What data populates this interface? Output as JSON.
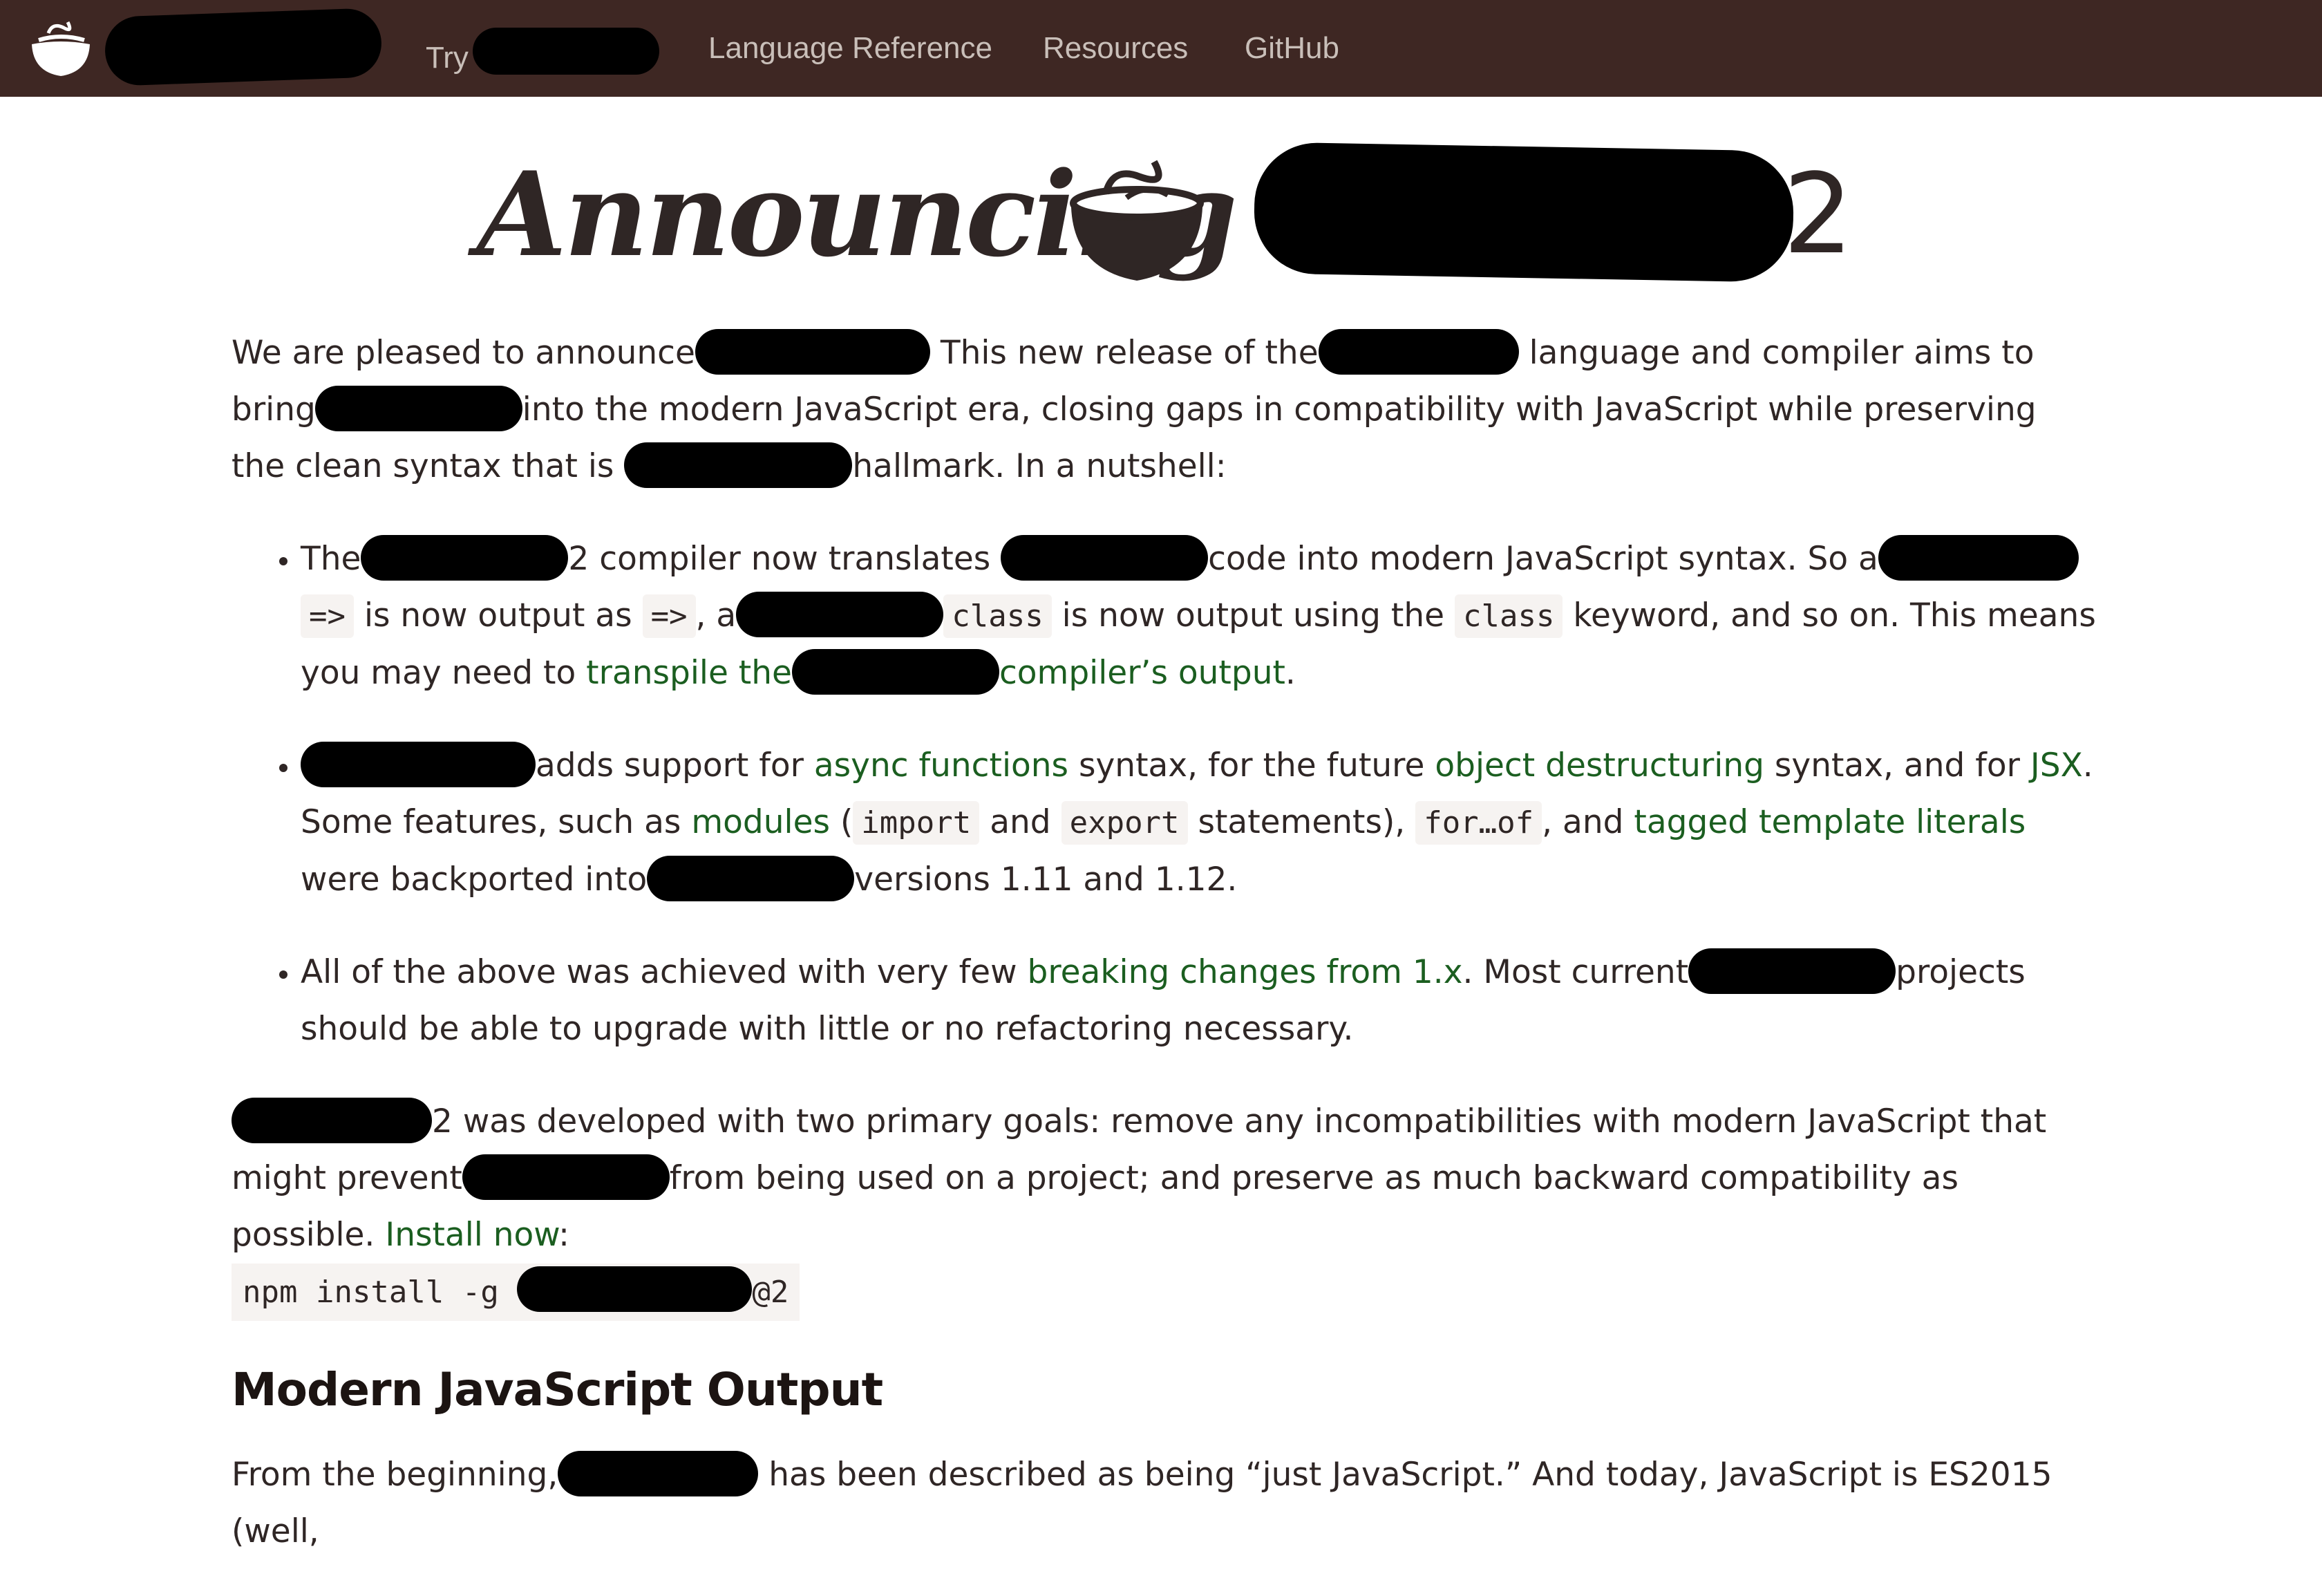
{
  "nav": {
    "try_label": "Try",
    "language_reference": "Language Reference",
    "resources": "Resources",
    "github": "GitHub"
  },
  "hero": {
    "announcing": "Announcing",
    "version": "2"
  },
  "intro": {
    "p1_a": "We are pleased to announce",
    "p1_b": "This new release of the",
    "p1_c": "language and compiler aims to bring",
    "p1_d": "into the modern JavaScript era, closing gaps in compatibility with JavaScript while preserving the clean syntax that is",
    "p1_e": "hallmark. In a nutshell:"
  },
  "bullets": {
    "b1_a": "The",
    "b1_b": "2 compiler now translates",
    "b1_c": "code into modern JavaScript syntax. So a",
    "b1_code1": "=>",
    "b1_d": "is now output as",
    "b1_code2": "=>",
    "b1_e": ", a",
    "b1_code3": "class",
    "b1_f": "is now output using the",
    "b1_code4": "class",
    "b1_g": "keyword, and so on. This means you may need to",
    "b1_link1": "transpile the",
    "b1_link2": "compiler’s output",
    "b1_h": ".",
    "b2_a": "adds support for",
    "b2_link_async": "async functions",
    "b2_b": "syntax, for the future",
    "b2_link_destr": "object destructuring",
    "b2_c": "syntax, and for",
    "b2_link_jsx": "JSX",
    "b2_d": ". Some features, such as",
    "b2_link_modules": "modules",
    "b2_e": "(",
    "b2_code_import": "import",
    "b2_f": "and",
    "b2_code_export": "export",
    "b2_g": "statements),",
    "b2_code_forof": "for…of",
    "b2_h": ", and",
    "b2_link_tagged": "tagged template literals",
    "b2_i": "were backported into",
    "b2_j": "versions 1.11 and 1.12.",
    "b3_a": "All of the above was achieved with very few",
    "b3_link": "breaking changes from 1.x",
    "b3_b": ". Most current",
    "b3_c": "projects should be able to upgrade with little or no refactoring necessary."
  },
  "goals": {
    "a": "2 was developed with two primary goals: remove any incompatibilities with modern JavaScript that might prevent",
    "b": "from being used on a project; and preserve as much backward compatibility as possible.",
    "install_link": "Install now",
    "colon": ":",
    "cmd_prefix": "npm install -g",
    "cmd_suffix": "@2"
  },
  "section": {
    "heading": "Modern JavaScript Output",
    "p_a": "From the beginning,",
    "p_b": "has been described as being “just JavaScript.” And today, JavaScript is ES2015 (well,"
  }
}
